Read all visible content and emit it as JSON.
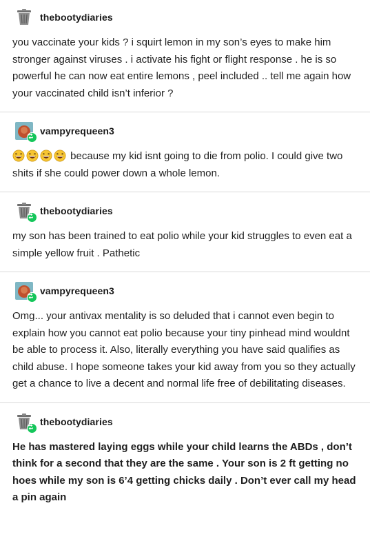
{
  "posts": [
    {
      "username": "thebootydiaries",
      "avatar": "trash-can-icon",
      "reblogged": false,
      "text": "you vaccinate your kids ? i squirt lemon in my son’s eyes to make him stronger against viruses . i activate his fight or flight response . he is so powerful he can now eat entire lemons , peel included .. tell me again how your vaccinated child isn’t inferior ?"
    },
    {
      "username": "vampyrequeen3",
      "avatar": "profile-photo-icon",
      "reblogged": true,
      "emojis": [
        "laughing-face-emoji",
        "laughing-face-emoji",
        "laughing-face-emoji",
        "laughing-face-emoji"
      ],
      "text": "because my kid isnt going to die from polio. I could give two shits if she could power down a whole lemon."
    },
    {
      "username": "thebootydiaries",
      "avatar": "trash-can-icon",
      "reblogged": true,
      "text": "my son has been trained to eat polio while your kid struggles to even eat a simple yellow fruit . Pathetic"
    },
    {
      "username": "vampyrequeen3",
      "avatar": "profile-photo-icon",
      "reblogged": true,
      "text": "Omg... your antivax mentality is so deluded that i cannot even begin to explain how you cannot eat polio because your tiny pinhead mind wouldnt be able to process it. Also, literally everything you have said qualifies as child abuse. I hope someone takes your kid away from you so they actually get a chance to live a decent and normal life free of debilitating diseases."
    },
    {
      "username": "thebootydiaries",
      "avatar": "trash-can-icon",
      "reblogged": true,
      "text": "He has mastered laying eggs while your child learns the ABDs , don’t think for a second that they are the same . Your son is 2 ft getting no hoes while my son is 6’4 getting chicks daily . Don’t ever call my head a pin again"
    }
  ],
  "colors": {
    "reblog_badge": "#14c65a",
    "divider": "#d9d9d9",
    "text": "#1f1f1f"
  }
}
